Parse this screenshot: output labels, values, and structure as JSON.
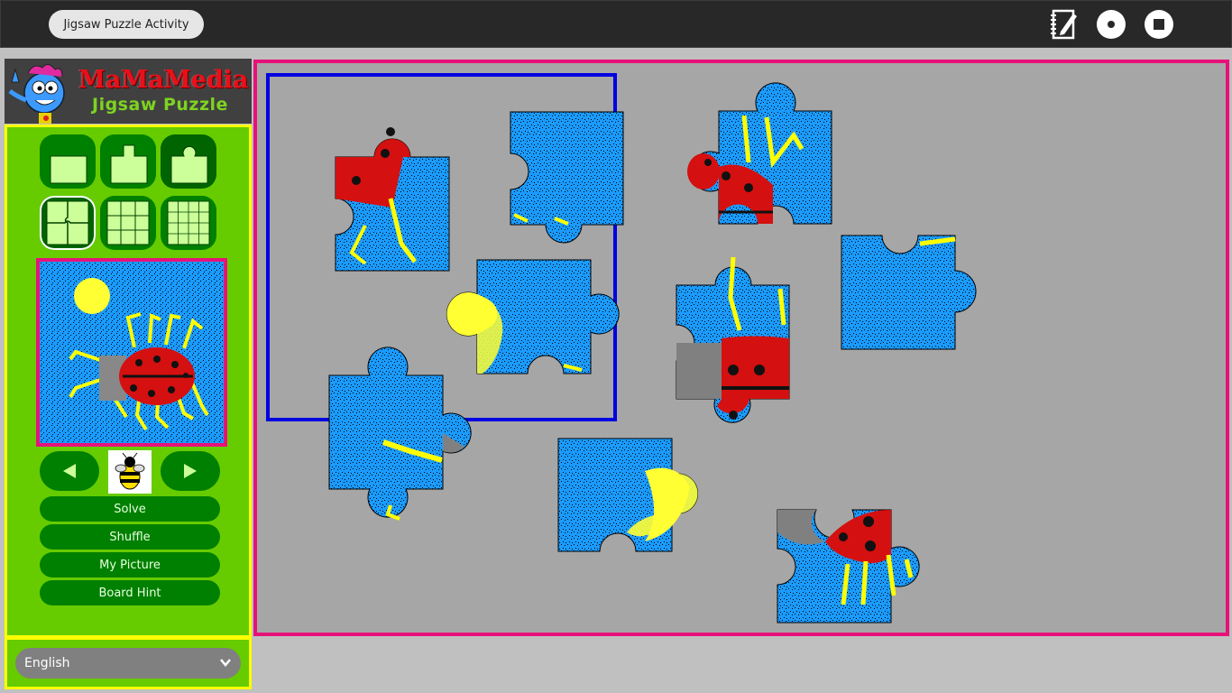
{
  "window": {
    "activity_title": "Jigsaw Puzzle Activity"
  },
  "toolbar": {
    "icons": [
      "journal-icon",
      "share-icon",
      "stop-icon"
    ]
  },
  "logo": {
    "line1": "MaMaMedia",
    "line2": "Jigsaw Puzzle"
  },
  "cut_styles": {
    "selected_index": 3,
    "items": [
      "no-knob-icon",
      "square-knob-icon",
      "round-knob-icon",
      "4-piece-icon",
      "9-piece-icon",
      "16-piece-icon"
    ]
  },
  "navigation": {
    "prev_icon": "left-arrow-icon",
    "next_icon": "right-arrow-icon",
    "thumbnail": "bee-icon"
  },
  "actions": {
    "solve": "Solve",
    "shuffle": "Shuffle",
    "my_picture": "My Picture",
    "board_hint": "Board Hint"
  },
  "language": {
    "selected": "English"
  },
  "colors": {
    "panel_green": "#66cc00",
    "button_green": "#008000",
    "panel_border": "#ffff00",
    "board_border": "#e6127a",
    "board_bg": "#a6a6a6",
    "hint_frame": "#0000e0",
    "puzzle_blue": "#1a9bff",
    "ladybug_red": "#d41010"
  }
}
